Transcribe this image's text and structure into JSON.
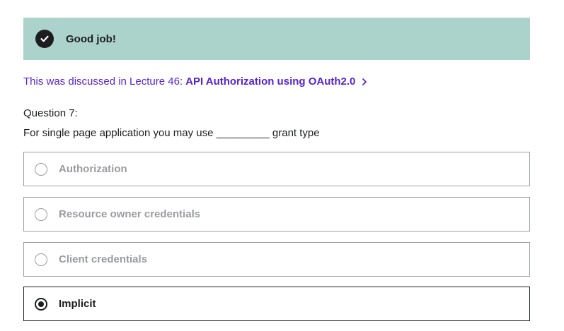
{
  "result_banner": {
    "icon": "check-circle-icon",
    "text": "Good job!",
    "background_color": "#acd2cc"
  },
  "lecture_reference": {
    "prefix": "This was discussed in Lecture 46:",
    "title": "API Authorization using OAuth2.0",
    "icon": "chevron-right-icon",
    "color": "#5624d0"
  },
  "question": {
    "number_label": "Question 7:",
    "text": "For single page application you may use _________ grant type"
  },
  "answers": [
    {
      "label": "Authorization",
      "selected": false
    },
    {
      "label": "Resource owner credentials",
      "selected": false
    },
    {
      "label": "Client credentials",
      "selected": false
    },
    {
      "label": "Implicit",
      "selected": true
    }
  ]
}
